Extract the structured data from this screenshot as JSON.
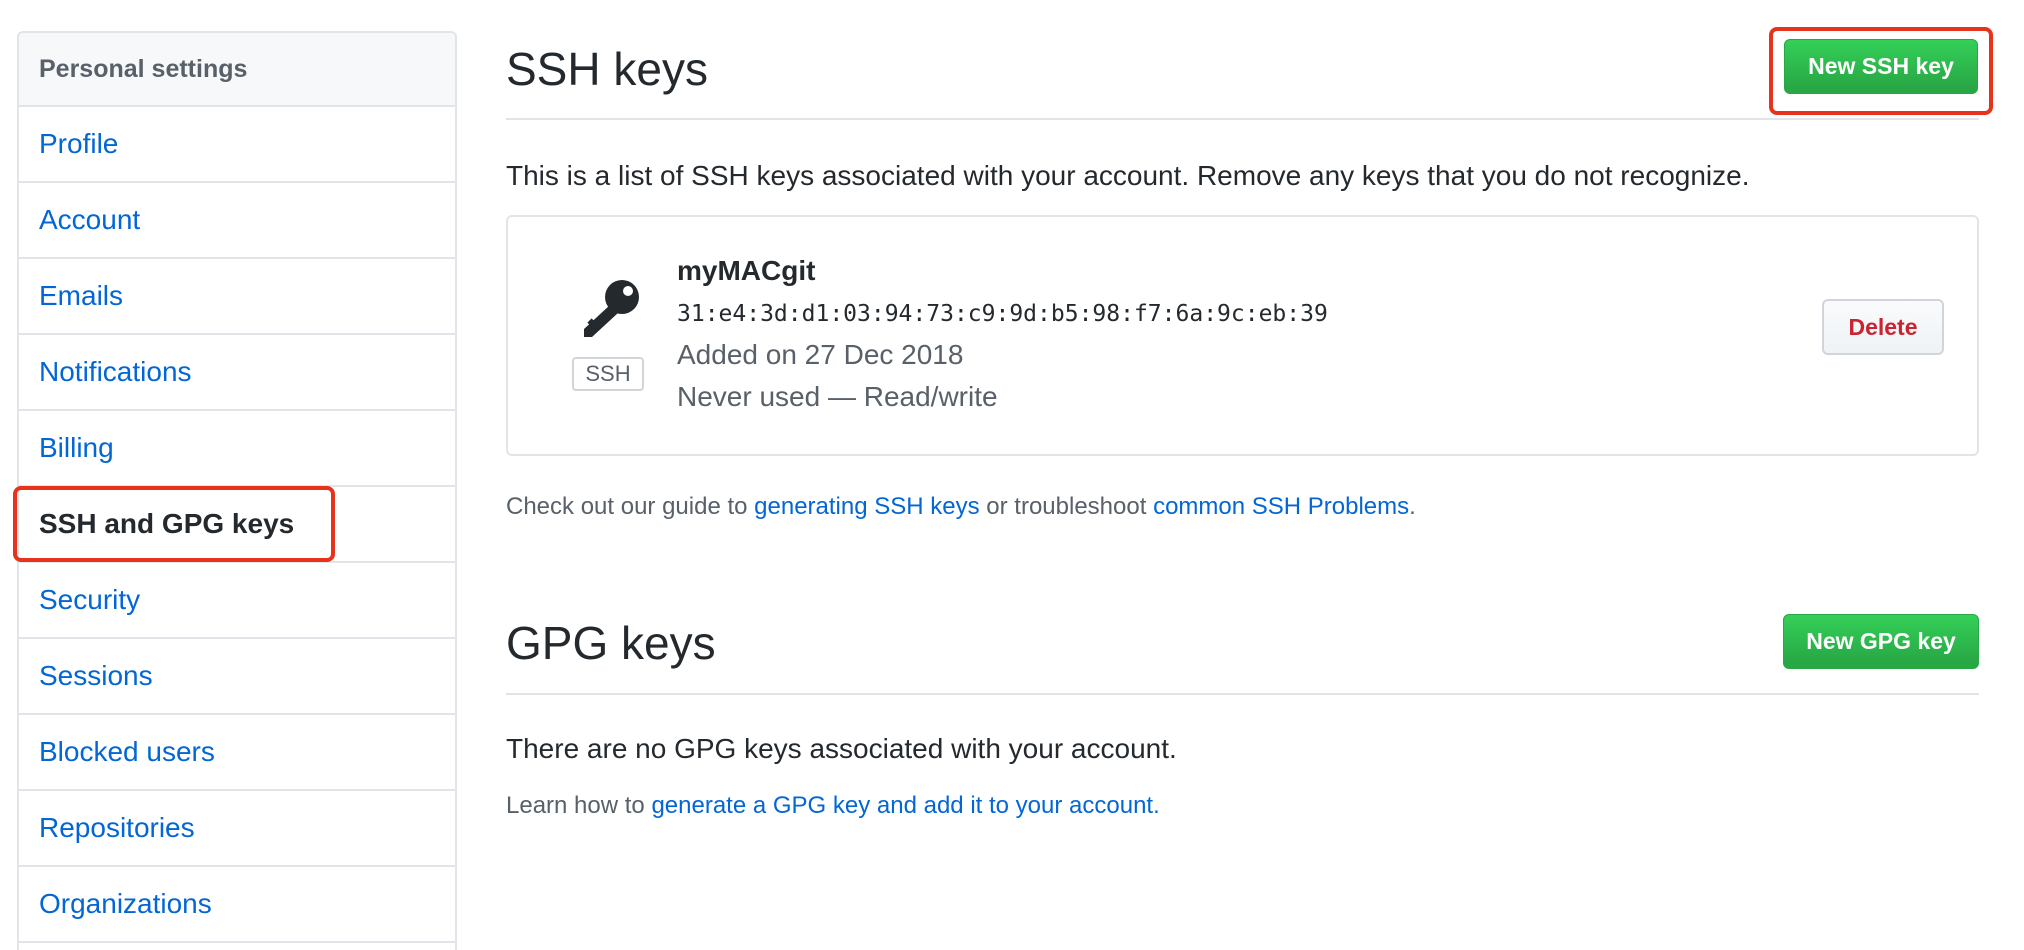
{
  "sidebar": {
    "header": "Personal settings",
    "items": [
      {
        "label": "Profile"
      },
      {
        "label": "Account"
      },
      {
        "label": "Emails"
      },
      {
        "label": "Notifications"
      },
      {
        "label": "Billing"
      },
      {
        "label": "SSH and GPG keys",
        "active": true
      },
      {
        "label": "Security"
      },
      {
        "label": "Sessions"
      },
      {
        "label": "Blocked users"
      },
      {
        "label": "Repositories"
      },
      {
        "label": "Organizations"
      }
    ]
  },
  "ssh": {
    "title": "SSH keys",
    "new_button": "New SSH key",
    "description": "This is a list of SSH keys associated with your account. Remove any keys that you do not recognize.",
    "keys": [
      {
        "badge": "SSH",
        "name": "myMACgit",
        "fingerprint": "31:e4:3d:d1:03:94:73:c9:9d:b5:98:f7:6a:9c:eb:39",
        "added": "Added on 27 Dec 2018",
        "usage": "Never used — Read/write",
        "delete_label": "Delete"
      }
    ],
    "guide": {
      "prefix": "Check out our guide to ",
      "link1": "generating SSH keys",
      "middle": " or troubleshoot ",
      "link2": "common SSH Problems",
      "suffix": "."
    }
  },
  "gpg": {
    "title": "GPG keys",
    "new_button": "New GPG key",
    "empty_text": "There are no GPG keys associated with your account.",
    "learn": {
      "prefix": "Learn how to ",
      "link": "generate a GPG key and add it to your account",
      "suffix": "."
    }
  },
  "colors": {
    "link": "#0366d6",
    "green_button": "#28a745",
    "delete_text": "#cb2431",
    "highlight": "#e8331c"
  }
}
